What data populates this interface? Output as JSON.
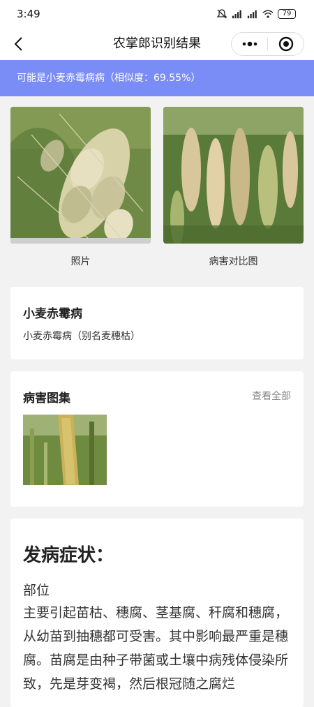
{
  "status": {
    "time": "3:49",
    "battery": "79"
  },
  "nav": {
    "title": "农掌郎识别结果"
  },
  "banner": {
    "text": "可能是小麦赤霉病病（相似度：69.55%）"
  },
  "photos": {
    "photo_caption": "照片",
    "compare_caption": "病害对比图"
  },
  "disease": {
    "name": "小麦赤霉病",
    "alias": "小麦赤霉病（别名麦穗枯）"
  },
  "gallery": {
    "title": "病害图集",
    "view_all": "查看全部"
  },
  "symptoms": {
    "heading": "发病症状：",
    "part_label": "部位",
    "body": "主要引起苗枯、穗腐、茎基腐、秆腐和穗腐，从幼苗到抽穗都可受害。其中影响最严重是穗腐。苗腐是由种子带菌或土壤中病残体侵染所致，先是芽变褐，然后根冠随之腐烂"
  },
  "icons": {
    "back": "back-arrow-icon",
    "more": "more-dots-icon",
    "target": "target-circle-icon",
    "mute": "bell-muted-icon",
    "signal": "signal-icon",
    "wifi": "wifi-icon"
  },
  "colors": {
    "banner": "#7a8cf5",
    "background": "#f2f2f2"
  }
}
